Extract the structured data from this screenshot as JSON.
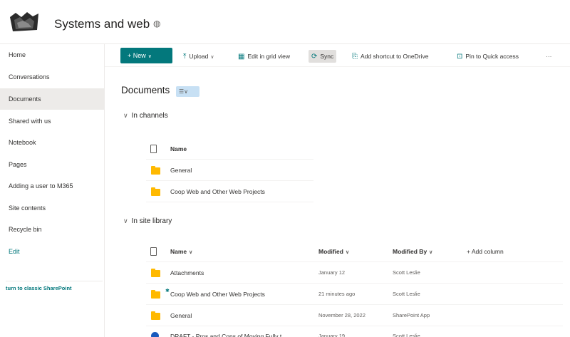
{
  "header": {
    "site_title": "Systems and web",
    "privacy_icon": "globe-icon"
  },
  "sidebar": {
    "items": [
      {
        "label": "Home"
      },
      {
        "label": "Conversations"
      },
      {
        "label": "Documents"
      },
      {
        "label": "Shared with us"
      },
      {
        "label": "Notebook"
      },
      {
        "label": "Pages"
      },
      {
        "label": "Adding a user to M365"
      },
      {
        "label": "Site contents"
      },
      {
        "label": "Recycle bin"
      },
      {
        "label": "Edit"
      }
    ],
    "active_item": "Documents",
    "return_link": "turn to classic SharePoint"
  },
  "toolbar": {
    "new_label": "New",
    "upload_label": "Upload",
    "grid_label": "Edit in grid view",
    "sync_label": "Sync",
    "shortcut_label": "Add shortcut to OneDrive",
    "pin_label": "Pin to Quick access",
    "more_label": "···"
  },
  "library": {
    "title": "Documents",
    "view_switcher": "☰∨"
  },
  "channels": {
    "heading": "In channels",
    "name_header": "Name",
    "rows": [
      {
        "name": "General"
      },
      {
        "name": "Coop Web and Other Web Projects"
      }
    ]
  },
  "site_library": {
    "heading": "In site library",
    "headers": {
      "name": "Name",
      "modified": "Modified",
      "modified_by": "Modified By",
      "add_column": "+ Add column"
    },
    "rows": [
      {
        "name": "Attachments",
        "modified": "January 12",
        "modified_by": "Scott Leslie"
      },
      {
        "name": "Coop Web and Other Web Projects",
        "modified": "21 minutes ago",
        "modified_by": "Scott Leslie"
      },
      {
        "name": "General",
        "modified": "November 28, 2022",
        "modified_by": "SharePoint App"
      },
      {
        "name": "DRAFT - Pros and Cons of Moving Fully t...",
        "modified": "January 19",
        "modified_by": "Scott Leslie"
      }
    ]
  },
  "colors": {
    "accent": "#03787c",
    "folder": "#ffb900",
    "active_nav": "#edebe9"
  }
}
